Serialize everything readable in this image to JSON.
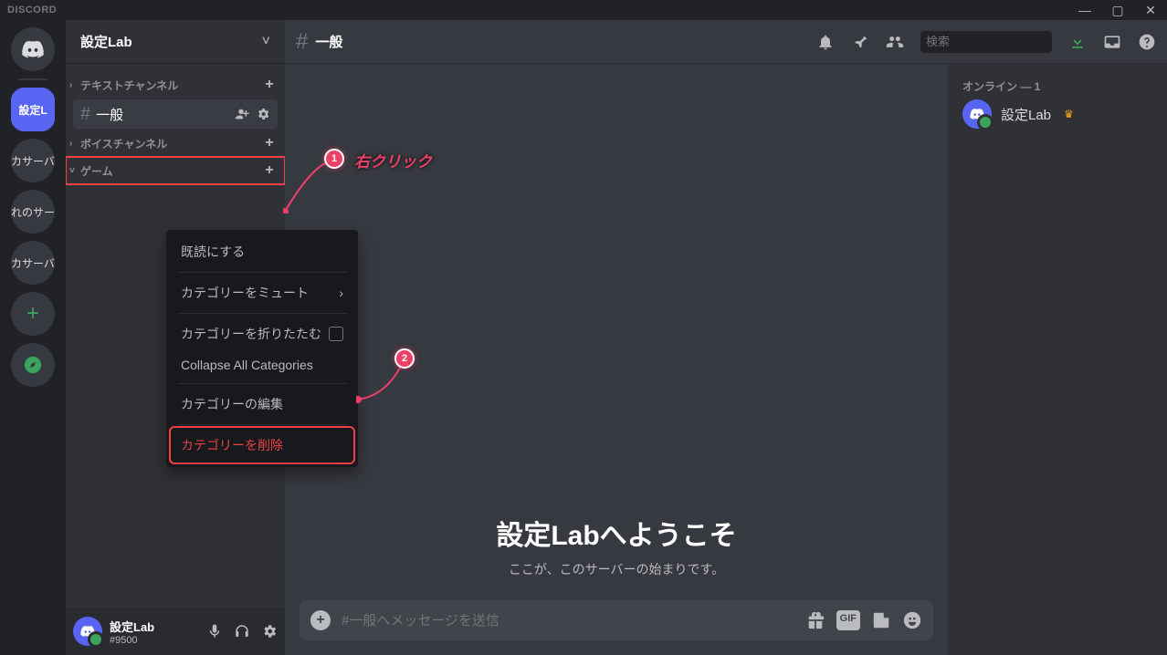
{
  "titlebar": {
    "logo": "DISCORD"
  },
  "servers": {
    "selected_label": "設定L",
    "items": [
      "カサーバ",
      "れのサー",
      "カサーバ"
    ]
  },
  "server_header": {
    "name": "設定Lab"
  },
  "categories": {
    "text": {
      "label": "テキストチャンネル"
    },
    "voice": {
      "label": "ボイスチャンネル"
    },
    "game": {
      "label": "ゲーム"
    }
  },
  "channels": {
    "general": "一般"
  },
  "user": {
    "name": "設定Lab",
    "tag": "#9500"
  },
  "chat": {
    "channel": "一般",
    "welcome_title": "設定Labへようこそ",
    "welcome_sub": "ここが、このサーバーの始まりです。",
    "placeholder": "#一般へメッセージを送信",
    "search_placeholder": "検索"
  },
  "members": {
    "online_label": "オンライン — 1",
    "items": [
      {
        "name": "設定Lab",
        "owner": true
      }
    ]
  },
  "context_menu": {
    "mark_read": "既読にする",
    "mute": "カテゴリーをミュート",
    "collapse": "カテゴリーを折りたたむ",
    "collapse_all": "Collapse All Categories",
    "edit": "カテゴリーの編集",
    "delete": "カテゴリーを削除"
  },
  "annotations": {
    "b1": "1",
    "b2": "2",
    "label1": "右クリック"
  }
}
